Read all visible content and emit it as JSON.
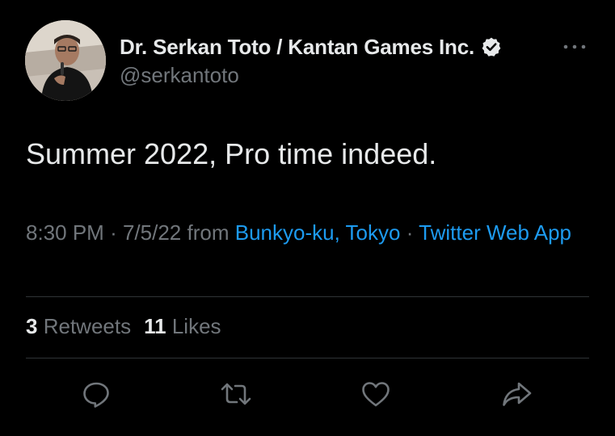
{
  "author": {
    "display_name": "Dr. Serkan Toto / Kantan Games Inc.",
    "handle": "@serkantoto",
    "verified": true
  },
  "tweet": {
    "text": "Summer 2022, Pro time indeed.",
    "time": "8:30 PM",
    "separator": "·",
    "date": "7/5/22",
    "from_label": "from",
    "location": "Bunkyo-ku, Tokyo",
    "source": "Twitter Web App"
  },
  "stats": {
    "retweets_count": "3",
    "retweets_label": "Retweets",
    "likes_count": "11",
    "likes_label": "Likes"
  },
  "actions": [
    {
      "icon": "reply-icon"
    },
    {
      "icon": "retweet-icon"
    },
    {
      "icon": "like-heart-icon"
    },
    {
      "icon": "share-icon"
    }
  ],
  "colors": {
    "background": "#000000",
    "primary_text": "#e7e9ea",
    "secondary_text": "#71767b",
    "link": "#1d9bf0",
    "divider": "#2f3336"
  }
}
